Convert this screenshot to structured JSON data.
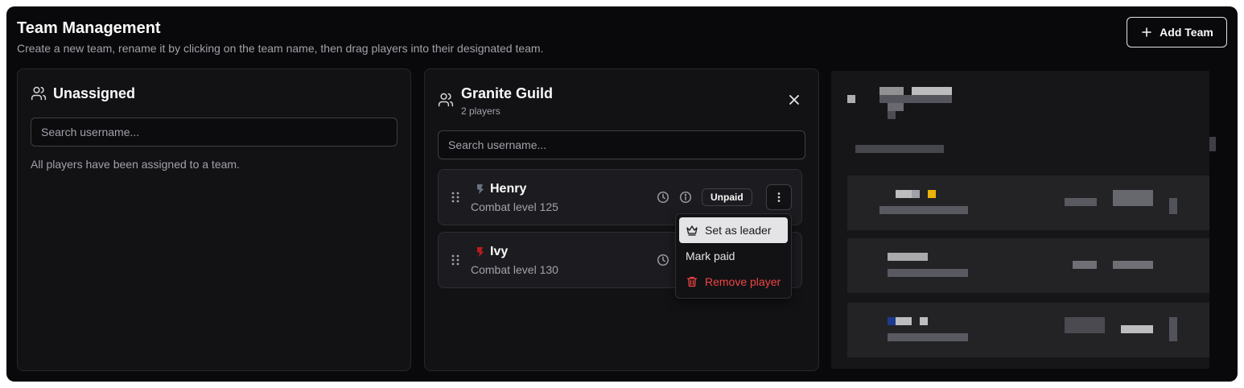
{
  "header": {
    "title": "Team Management",
    "subtitle": "Create a new team, rename it by clicking on the team name, then drag players into their designated team.",
    "add_team_label": "Add Team"
  },
  "unassigned": {
    "title": "Unassigned",
    "search_placeholder": "Search username...",
    "empty_text": "All players have been assigned to a team."
  },
  "team": {
    "name": "Granite Guild",
    "count_text": "2 players",
    "search_placeholder": "Search username...",
    "players": [
      {
        "name": "Henry",
        "level_text": "Combat level 125",
        "status": "Unpaid",
        "rank_color": "#6b7280"
      },
      {
        "name": "Ivy",
        "level_text": "Combat level 130",
        "rank_color": "#b91c1c"
      }
    ]
  },
  "player_menu": {
    "items": [
      {
        "label": "Set as leader",
        "icon": "crown-icon"
      },
      {
        "label": "Mark paid"
      },
      {
        "label": "Remove player",
        "icon": "trash-icon",
        "color": "#ef4444"
      }
    ]
  },
  "colors": {
    "background": "#09090b",
    "panel": "#121215",
    "danger": "#ef4444"
  }
}
